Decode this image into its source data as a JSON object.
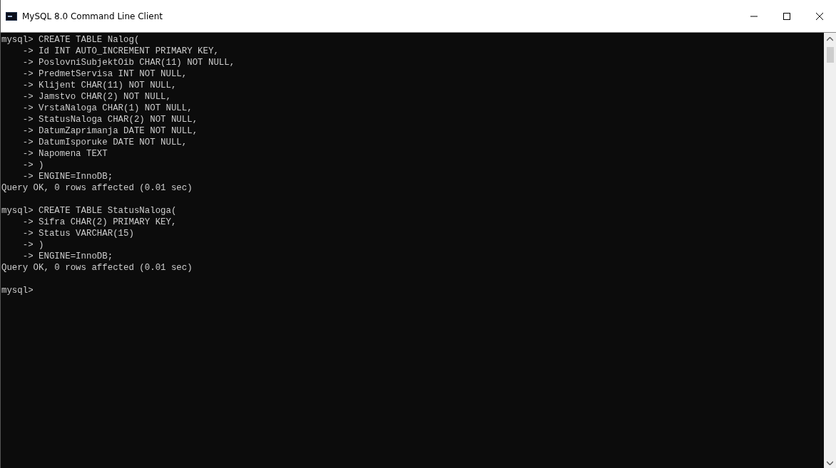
{
  "window": {
    "title": "MySQL 8.0 Command Line Client"
  },
  "console": {
    "blocks": [
      [
        "mysql> CREATE TABLE Nalog(",
        "    -> Id INT AUTO_INCREMENT PRIMARY KEY,",
        "    -> PoslovniSubjektOib CHAR(11) NOT NULL,",
        "    -> PredmetServisa INT NOT NULL,",
        "    -> Klijent CHAR(11) NOT NULL,",
        "    -> Jamstvo CHAR(2) NOT NULL,",
        "    -> VrstaNaloga CHAR(1) NOT NULL,",
        "    -> StatusNaloga CHAR(2) NOT NULL,",
        "    -> DatumZaprimanja DATE NOT NULL,",
        "    -> DatumIsporuke DATE NOT NULL,",
        "    -> Napomena TEXT",
        "    -> )",
        "    -> ENGINE=InnoDB;",
        "Query OK, 0 rows affected (0.01 sec)"
      ],
      [
        "mysql> CREATE TABLE StatusNaloga(",
        "    -> Sifra CHAR(2) PRIMARY KEY,",
        "    -> Status VARCHAR(15)",
        "    -> )",
        "    -> ENGINE=InnoDB;",
        "Query OK, 0 rows affected (0.01 sec)"
      ],
      [
        "mysql>"
      ]
    ]
  }
}
